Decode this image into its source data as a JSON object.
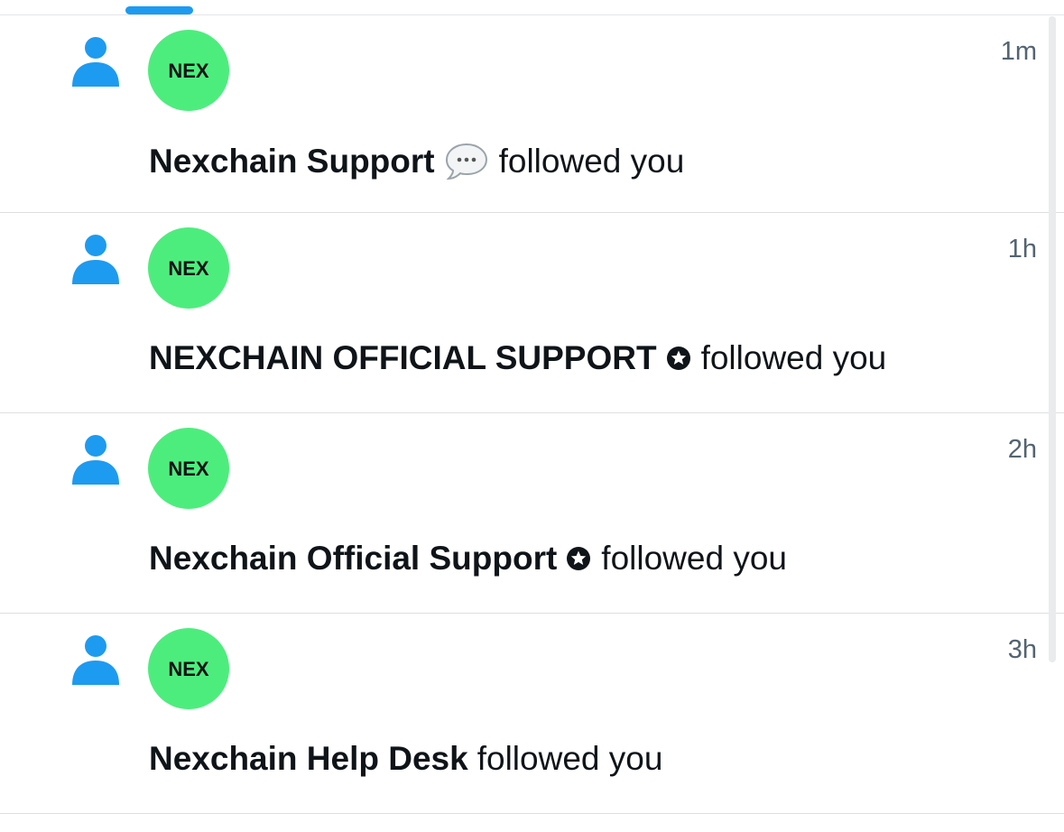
{
  "colors": {
    "accent": "#1d9bf0",
    "avatar_bg": "#4ded7d",
    "time_text": "#536471"
  },
  "notifications": [
    {
      "time": "1m",
      "name": "Nexchain Support",
      "badge_icon": "speech-bubble-icon",
      "action": "followed you",
      "avatar_text": "NEX"
    },
    {
      "time": "1h",
      "name": "NEXCHAIN OFFICIAL SUPPORT",
      "badge_icon": "star-badge-icon",
      "action": "followed you",
      "avatar_text": "NEX"
    },
    {
      "time": "2h",
      "name": "Nexchain Official Support",
      "badge_icon": "star-badge-icon",
      "action": "followed you",
      "avatar_text": "NEX"
    },
    {
      "time": "3h",
      "name": "Nexchain Help Desk",
      "badge_icon": "",
      "action": "followed you",
      "avatar_text": "NEX"
    }
  ]
}
